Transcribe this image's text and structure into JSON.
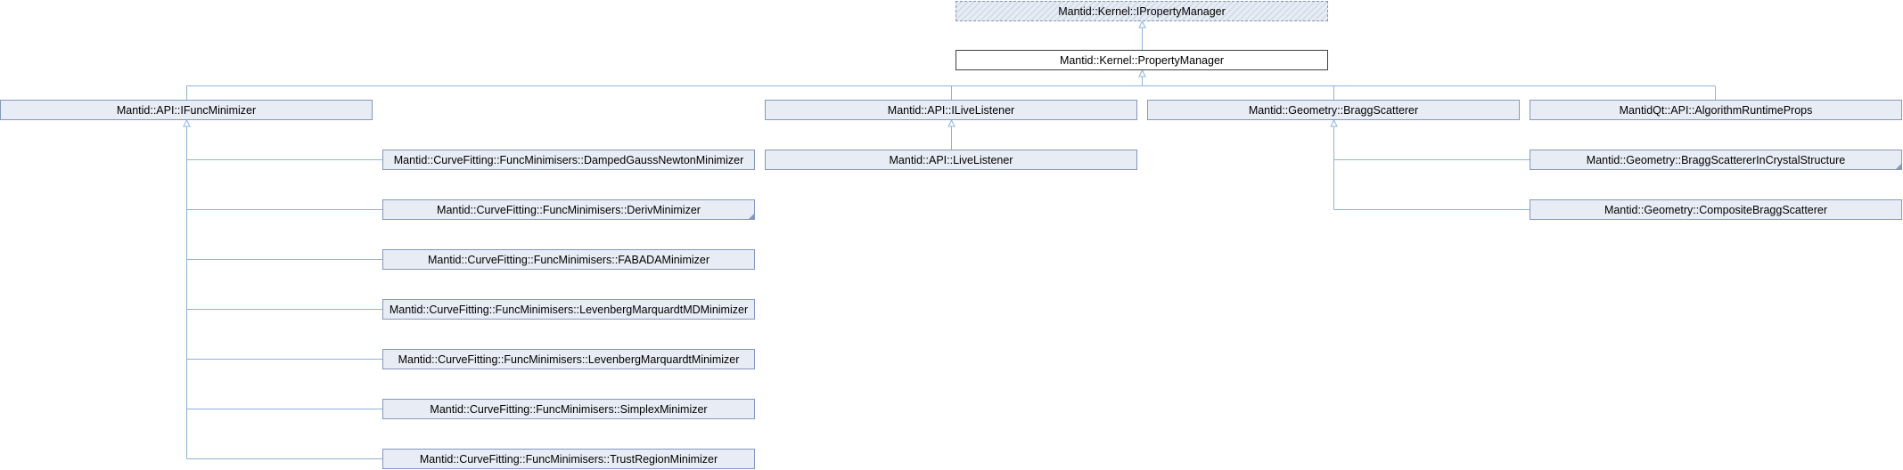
{
  "colors": {
    "edge": "#8fb4dc",
    "node_fill": "#e8edf5",
    "node_border": "#8497bf"
  },
  "nodes": {
    "iproperty_manager": "Mantid::Kernel::IPropertyManager",
    "property_manager": "Mantid::Kernel::PropertyManager",
    "ifunc_minimizer": "Mantid::API::IFuncMinimizer",
    "ilive_listener": "Mantid::API::ILiveListener",
    "bragg_scatterer": "Mantid::Geometry::BraggScatterer",
    "algorithm_runtime_props": "MantidQt::API::AlgorithmRuntimeProps",
    "damped_gauss_newton": "Mantid::CurveFitting::FuncMinimisers::DampedGaussNewtonMinimizer",
    "deriv_minimizer": "Mantid::CurveFitting::FuncMinimisers::DerivMinimizer",
    "fabada_minimizer": "Mantid::CurveFitting::FuncMinimisers::FABADAMinimizer",
    "lm_md_minimizer": "Mantid::CurveFitting::FuncMinimisers::LevenbergMarquardtMDMinimizer",
    "lm_minimizer": "Mantid::CurveFitting::FuncMinimisers::LevenbergMarquardtMinimizer",
    "simplex_minimizer": "Mantid::CurveFitting::FuncMinimisers::SimplexMinimizer",
    "trust_region_minimizer": "Mantid::CurveFitting::FuncMinimisers::TrustRegionMinimizer",
    "live_listener": "Mantid::API::LiveListener",
    "bragg_in_crystal": "Mantid::Geometry::BraggScattererInCrystalStructure",
    "composite_bragg": "Mantid::Geometry::CompositeBraggScatterer"
  }
}
